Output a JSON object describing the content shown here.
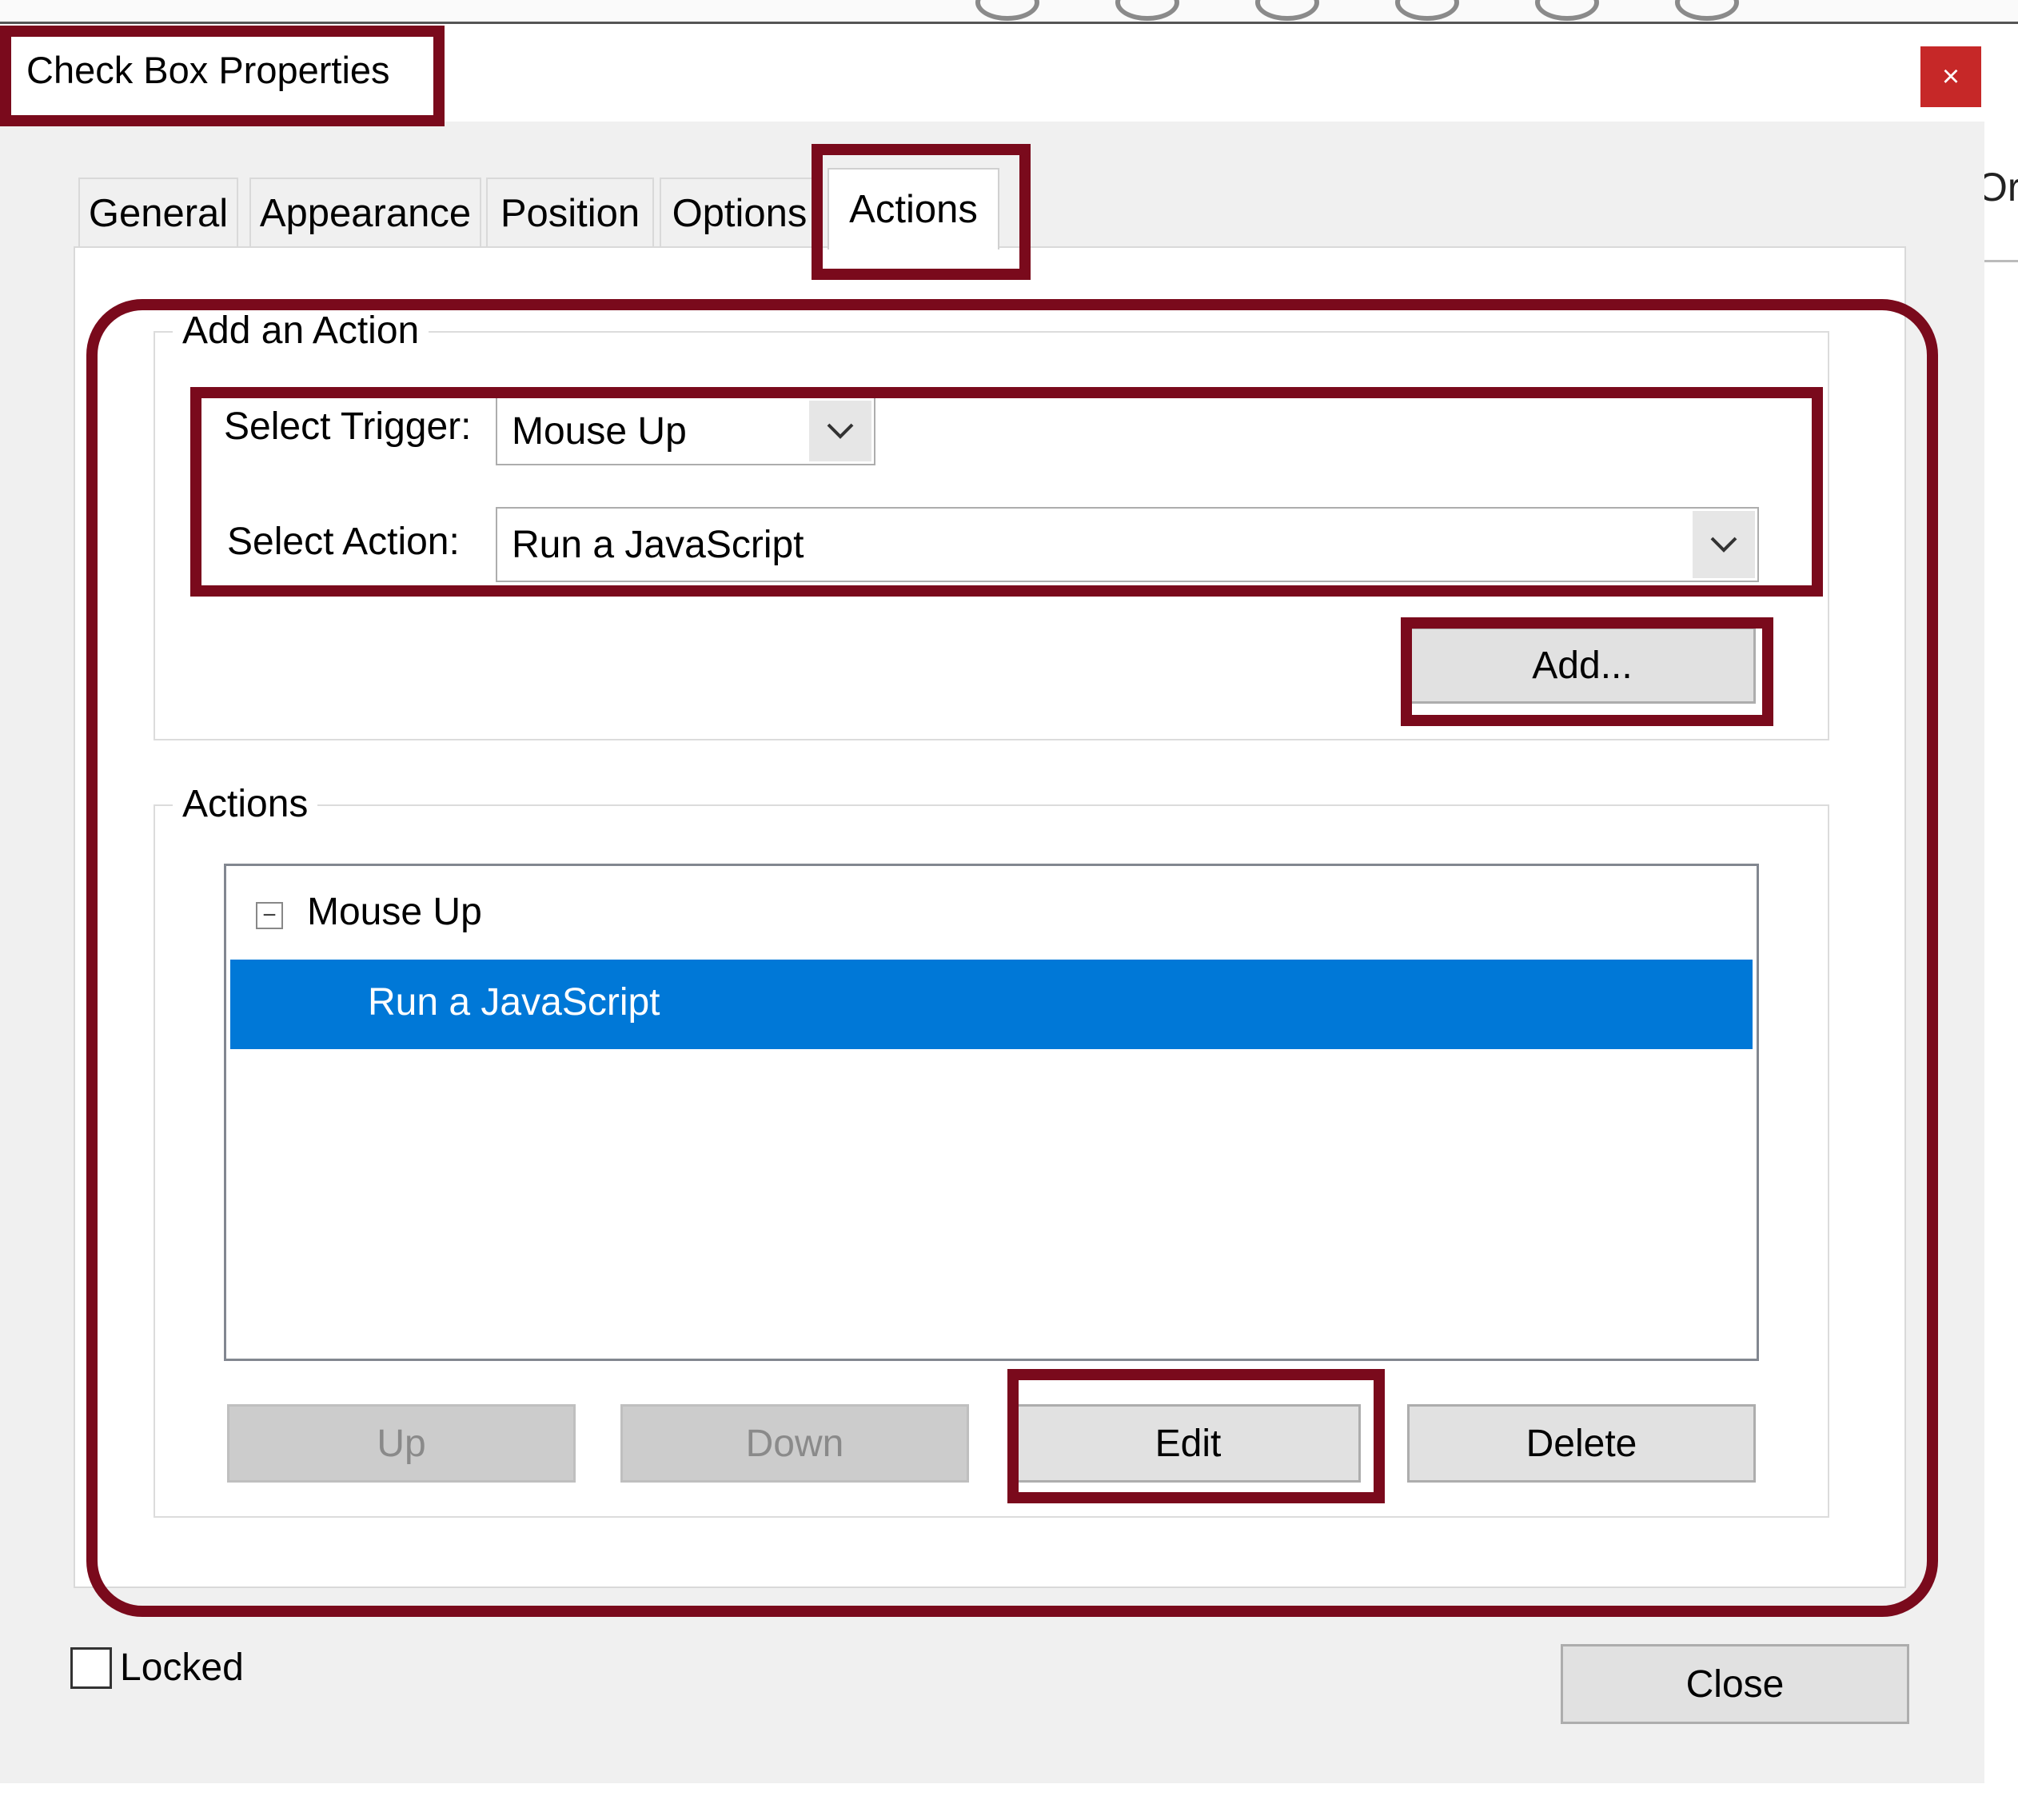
{
  "dialog": {
    "title": "Check Box Properties",
    "close_glyph": "×",
    "tabs": [
      "General",
      "Appearance",
      "Position",
      "Options",
      "Actions"
    ],
    "active_tab": "Actions"
  },
  "add_action": {
    "group_label": "Add an Action",
    "trigger_label": "Select Trigger:",
    "trigger_value": "Mouse Up",
    "action_label": "Select Action:",
    "action_value": "Run a JavaScript",
    "add_button": "Add..."
  },
  "actions": {
    "group_label": "Actions",
    "tree_toggle": "−",
    "tree_node": "Mouse Up",
    "selected_item": "Run a JavaScript",
    "buttons": {
      "up": "Up",
      "down": "Down",
      "edit": "Edit",
      "delete": "Delete"
    }
  },
  "footer": {
    "locked_label": "Locked",
    "locked_checked": false,
    "close_button": "Close"
  },
  "background": {
    "partial_text": "Or"
  },
  "icons": {
    "dropdown": "chevron-down-icon",
    "tree": "collapse-minus-icon",
    "close": "close-icon"
  },
  "colors": {
    "annotation": "#7a0a1c",
    "selection": "#0078d7",
    "close_button": "#c62828"
  }
}
